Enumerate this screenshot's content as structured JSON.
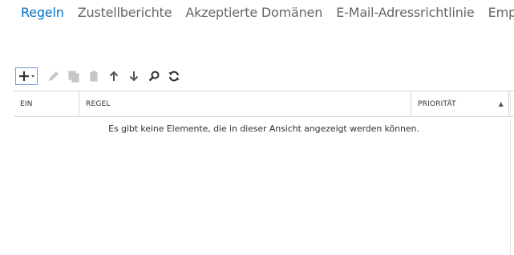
{
  "tabs": [
    {
      "label": "Regeln",
      "active": true
    },
    {
      "label": "Zustellberichte",
      "active": false
    },
    {
      "label": "Akzeptierte Domänen",
      "active": false
    },
    {
      "label": "E-Mail-Adressrichtlinie",
      "active": false
    },
    {
      "label": "Empfar",
      "active": false
    }
  ],
  "toolbar": {
    "icons": [
      "plus-dropdown-icon",
      "pencil-icon",
      "copy-icon",
      "trash-icon",
      "arrow-up-icon",
      "arrow-down-icon",
      "search-icon",
      "refresh-icon"
    ]
  },
  "grid": {
    "columns": {
      "ein": "EIN",
      "regel": "REGEL",
      "prioritaet": "PRIORITÄT"
    },
    "sort_indicator": "▲",
    "empty_message": "Es gibt keine Elemente, die in dieser Ansicht angezeigt werden können."
  },
  "colors": {
    "accent": "#0072c6",
    "tab_inactive": "#666666",
    "border": "#d4d4d4"
  }
}
